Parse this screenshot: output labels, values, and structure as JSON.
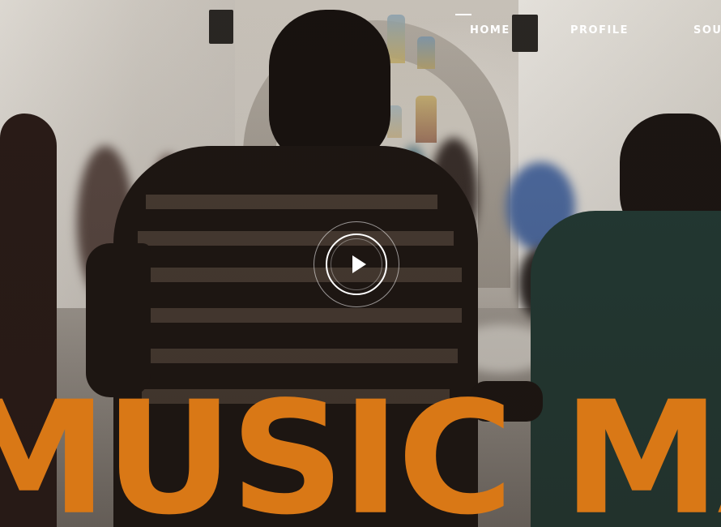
{
  "nav": {
    "items": [
      {
        "label": "HOME"
      },
      {
        "label": "PROFILE"
      },
      {
        "label": "SOU"
      }
    ]
  },
  "hero": {
    "headline": "MUSIC MA",
    "headline_color": "#d97816",
    "play_icon": "play-icon"
  },
  "colors": {
    "accent": "#d97816",
    "nav_text": "#ffffff"
  }
}
